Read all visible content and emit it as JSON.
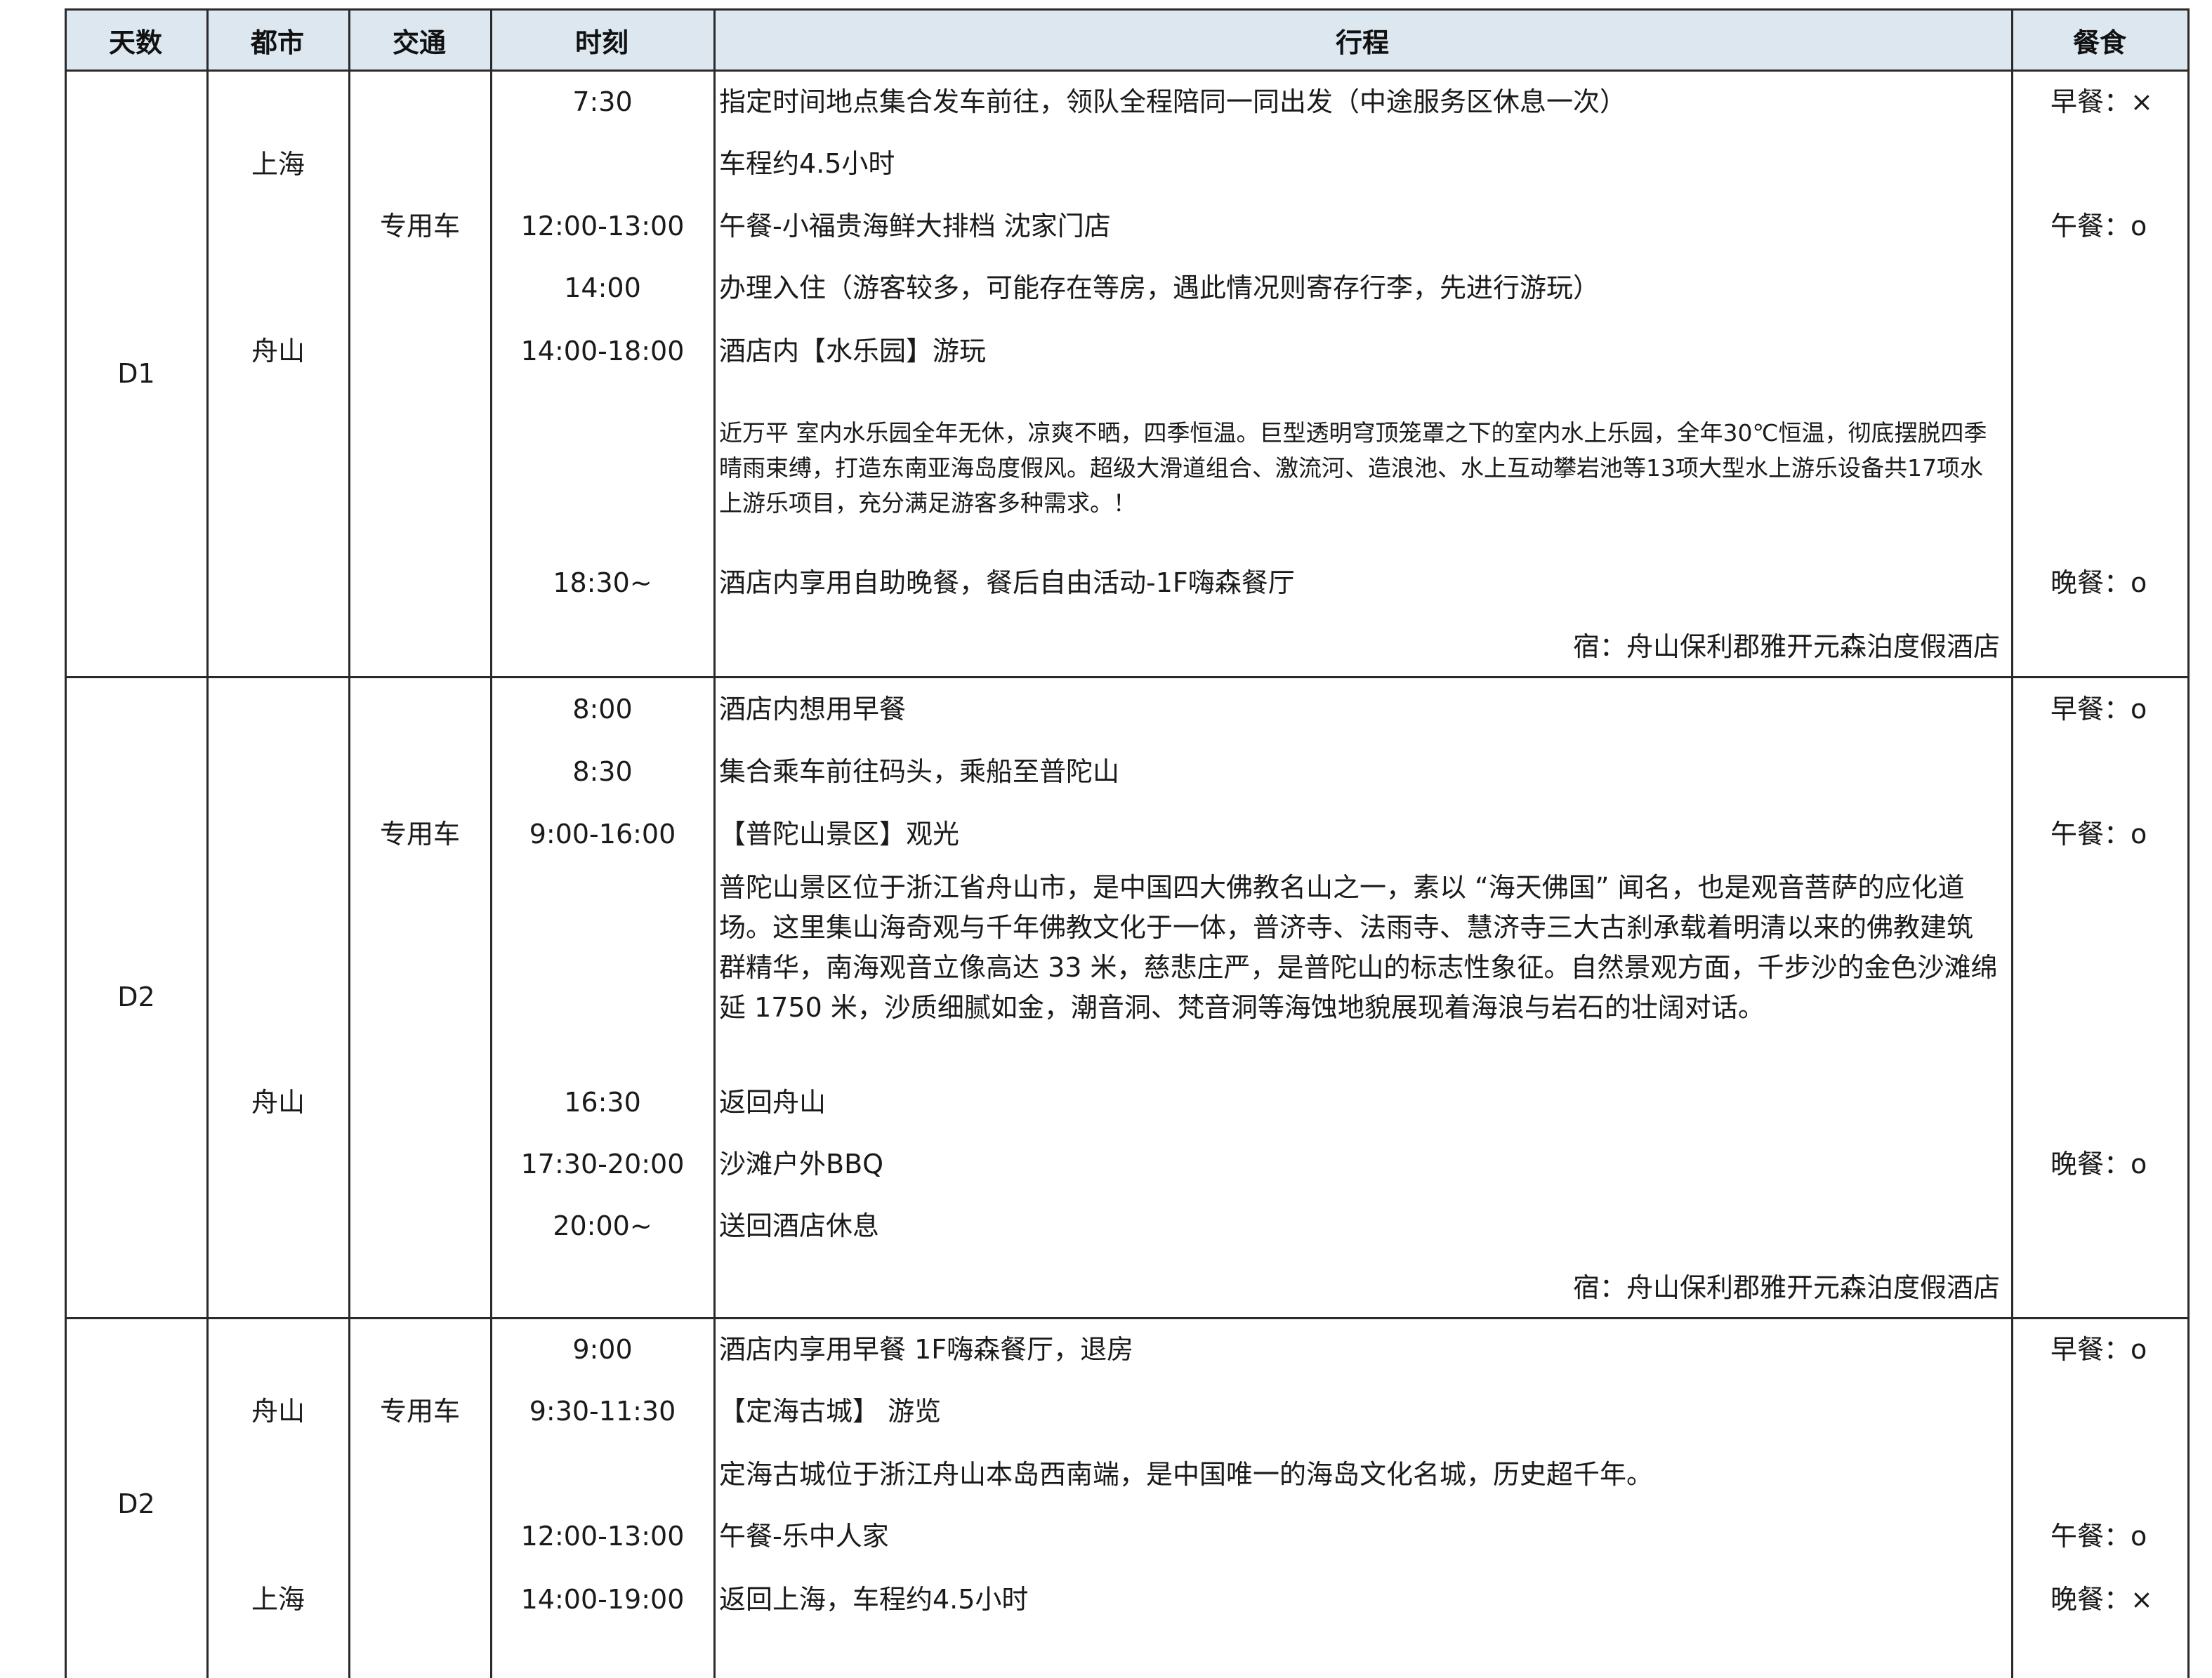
{
  "headers": {
    "day": "天数",
    "city": "都市",
    "transport": "交通",
    "time": "时刻",
    "itinerary": "行程",
    "meal": "餐食"
  },
  "d1": {
    "day": "D1",
    "city1": "上海",
    "city2": "舟山",
    "transport": "专用车",
    "rows": [
      {
        "time": "7:30",
        "item": "指定时间地点集合发车前往，领队全程陪同一同出发（中途服务区休息一次）",
        "meal": "早餐：×"
      },
      {
        "time": "",
        "item": "车程约4.5小时",
        "meal": ""
      },
      {
        "time": "12:00-13:00",
        "item": "午餐-小福贵海鲜大排档 沈家门店",
        "meal": "午餐：o"
      },
      {
        "time": "14:00",
        "item": "办理入住（游客较多，可能存在等房，遇此情况则寄存行李，先进行游玩）",
        "meal": ""
      },
      {
        "time": "14:00-18:00",
        "item": "酒店内【水乐园】游玩",
        "meal": ""
      },
      {
        "time": "18:30~",
        "item": "酒店内享用自助晚餐，餐后自由活动-1F嗨森餐厅",
        "meal": "晚餐：o"
      }
    ],
    "desc": "近万平 室内水乐园全年无休，凉爽不晒，四季恒温。巨型透明穹顶笼罩之下的室内水上乐园，全年30℃恒温，彻底摆脱四季晴雨束缚，打造东南亚海岛度假风。超级大滑道组合、激流河、造浪池、水上互动攀岩池等13项大型水上游乐设备共17项水上游乐项目，充分满足游客多种需求。！",
    "hotel": "宿：舟山保利郡雅开元森泊度假酒店"
  },
  "d2": {
    "day": "D2",
    "city": "舟山",
    "transport": "专用车",
    "rows": [
      {
        "time": "8:00",
        "item": "酒店内想用早餐",
        "meal": "早餐：o"
      },
      {
        "time": "8:30",
        "item": "集合乘车前往码头，乘船至普陀山",
        "meal": ""
      },
      {
        "time": "9:00-16:00",
        "item": "【普陀山景区】观光",
        "meal": "午餐：o"
      },
      {
        "time": "16:30",
        "item": "返回舟山",
        "meal": ""
      },
      {
        "time": "17:30-20:00",
        "item": "沙滩户外BBQ",
        "meal": "晚餐：o"
      },
      {
        "time": "20:00~",
        "item": "送回酒店休息",
        "meal": ""
      }
    ],
    "desc": "普陀山景区位于浙江省舟山市，是中国四大佛教名山之一，素以 “海天佛国” 闻名，也是观音菩萨的应化道场。这里集山海奇观与千年佛教文化于一体，普济寺、法雨寺、慧济寺三大古刹承载着明清以来的佛教建筑群精华，南海观音立像高达 33 米，慈悲庄严，是普陀山的标志性象征。自然景观方面，千步沙的金色沙滩绵延 1750 米，沙质细腻如金，潮音洞、梵音洞等海蚀地貌展现着海浪与岩石的壮阔对话。",
    "hotel": "宿：舟山保利郡雅开元森泊度假酒店"
  },
  "d3": {
    "day": "D2",
    "city1": "舟山",
    "city2": "上海",
    "transport": "专用车",
    "rows": [
      {
        "time": "9:00",
        "item": "酒店内享用早餐 1F嗨森餐厅，退房",
        "meal": "早餐：o"
      },
      {
        "time": "9:30-11:30",
        "item": "【定海古城】 游览",
        "meal": ""
      },
      {
        "time": "",
        "item": "定海古城位于浙江舟山本岛西南端，是中国唯一的海岛文化名城，历史超千年。",
        "meal": ""
      },
      {
        "time": "12:00-13:00",
        "item": "午餐-乐中人家",
        "meal": "午餐：o"
      },
      {
        "time": "14:00-19:00",
        "item": "返回上海，车程约4.5小时",
        "meal": "晚餐：×"
      }
    ]
  }
}
